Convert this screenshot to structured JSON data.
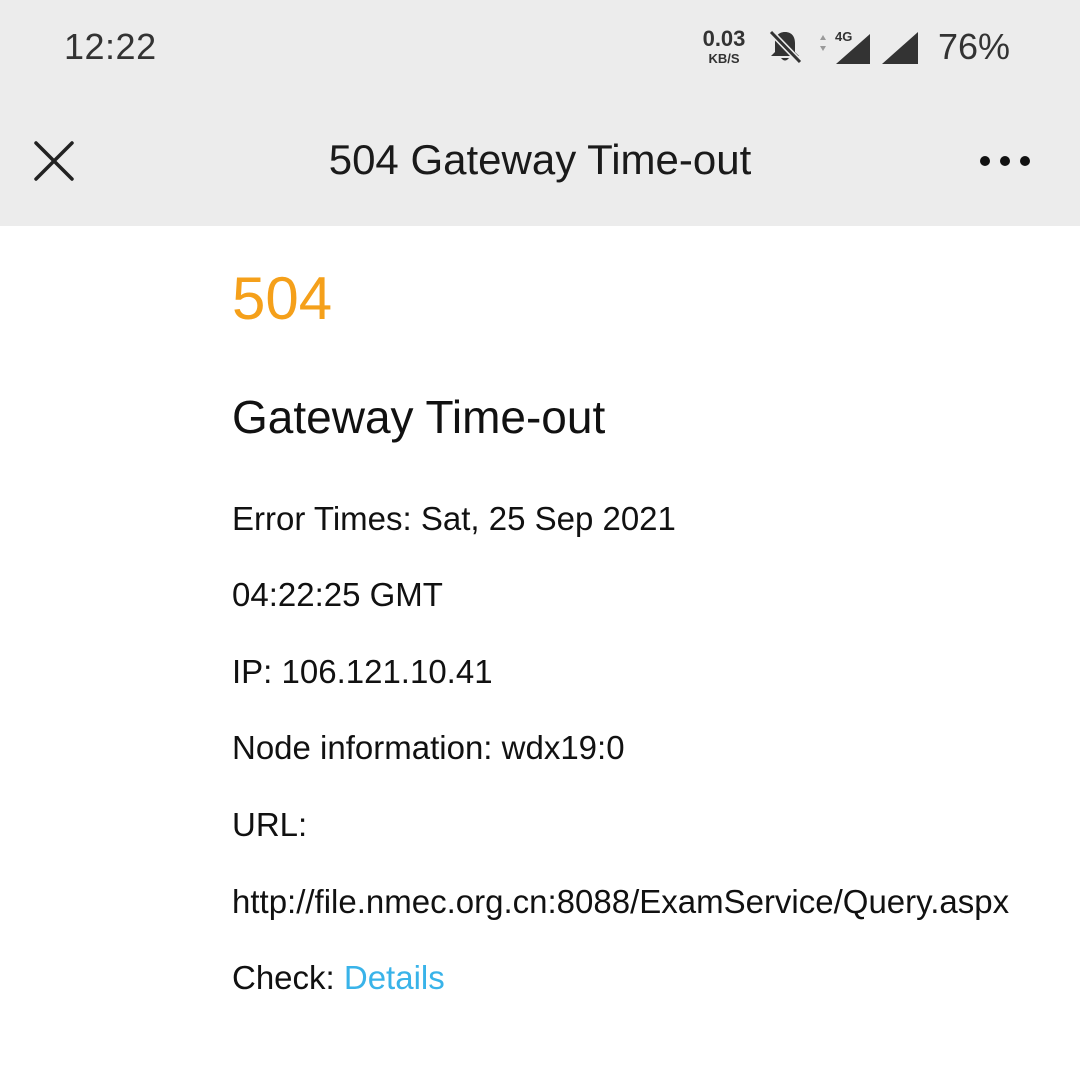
{
  "status_bar": {
    "time": "12:22",
    "net_speed_value": "0.03",
    "net_speed_unit": "KB/S",
    "network_type": "4G",
    "battery": "76%",
    "icons": [
      "bell-off-icon",
      "signal-4g-icon",
      "signal-icon"
    ]
  },
  "app_bar": {
    "title": "504 Gateway Time-out",
    "close_icon": "close-icon",
    "more_icon": "more-horizontal-icon"
  },
  "error": {
    "code": "504",
    "code_color": "#f5a01a",
    "title": "Gateway Time-out",
    "error_times_line1": "Error Times: Sat, 25 Sep 2021",
    "error_times_line2": "04:22:25 GMT",
    "ip": "IP: 106.121.10.41",
    "node": "Node information: wdx19:0",
    "url_label": "URL:",
    "url": "http://file.nmec.org.cn:8088/ExamService/Query.aspx",
    "check_label": "Check: ",
    "details_link": "Details",
    "link_color": "#39b3e9"
  }
}
